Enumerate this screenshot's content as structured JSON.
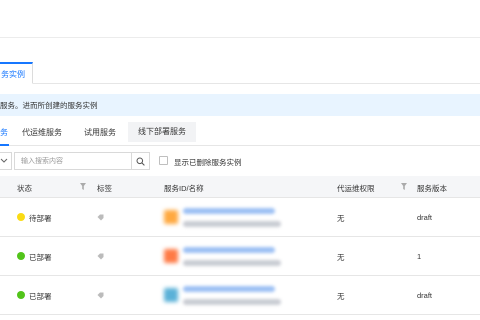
{
  "tab_active": "务实例",
  "notice": "服务。进而所创建的服务实例",
  "subtabs": [
    "务",
    "代运维服务",
    "试用服务",
    "线下部署服务"
  ],
  "search": {
    "placeholder": "输入搜索内容"
  },
  "show_deleted_label": "显示已删除服务实例",
  "columns": [
    "状态",
    "标签",
    "服务ID/名称",
    "代运维权限",
    "服务版本"
  ],
  "rows": [
    {
      "status": "待部署",
      "status_color": "#fadb14",
      "permission": "无",
      "version": "draft",
      "logo_color": "#ffa940"
    },
    {
      "status": "已部署",
      "status_color": "#52c41a",
      "permission": "无",
      "version": "1",
      "logo_color": "#ff7a45"
    },
    {
      "status": "已部署",
      "status_color": "#52c41a",
      "permission": "无",
      "version": "draft",
      "logo_color": "#5ab1d8"
    }
  ]
}
